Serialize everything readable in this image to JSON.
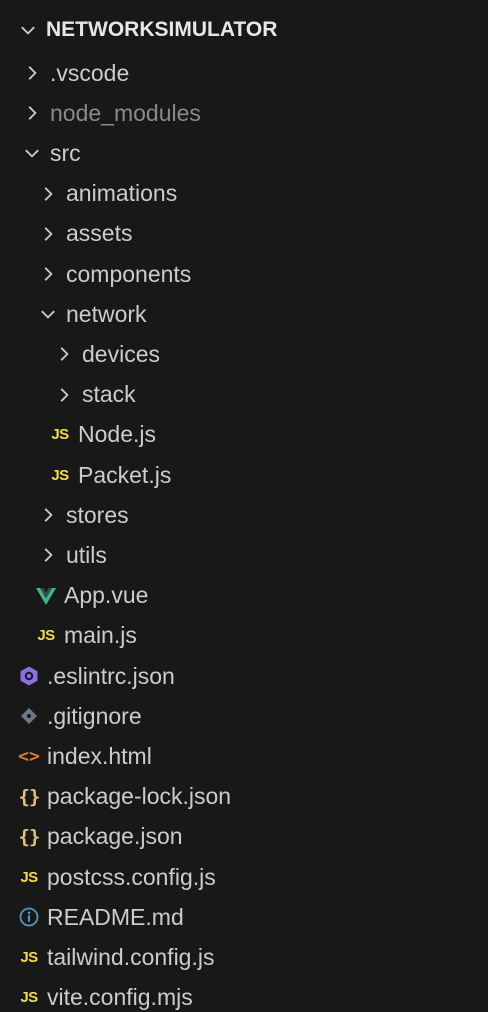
{
  "explorer": {
    "title": "NETWORKSIMULATOR",
    "items": [
      {
        "label": ".vscode",
        "type": "folder",
        "state": "collapsed",
        "depth": 1
      },
      {
        "label": "node_modules",
        "type": "folder",
        "state": "collapsed",
        "depth": 1,
        "dimmed": true
      },
      {
        "label": "src",
        "type": "folder",
        "state": "expanded",
        "depth": 1
      },
      {
        "label": "animations",
        "type": "folder",
        "state": "collapsed",
        "depth": 2
      },
      {
        "label": "assets",
        "type": "folder",
        "state": "collapsed",
        "depth": 2
      },
      {
        "label": "components",
        "type": "folder",
        "state": "collapsed",
        "depth": 2
      },
      {
        "label": "network",
        "type": "folder",
        "state": "expanded",
        "depth": 2
      },
      {
        "label": "devices",
        "type": "folder",
        "state": "collapsed",
        "depth": 3
      },
      {
        "label": "stack",
        "type": "folder",
        "state": "collapsed",
        "depth": 3
      },
      {
        "label": "Node.js",
        "type": "file",
        "icon": "javascript-icon",
        "icon_text": "JS",
        "depth": 3
      },
      {
        "label": "Packet.js",
        "type": "file",
        "icon": "javascript-icon",
        "icon_text": "JS",
        "depth": 3
      },
      {
        "label": "stores",
        "type": "folder",
        "state": "collapsed",
        "depth": 2
      },
      {
        "label": "utils",
        "type": "folder",
        "state": "collapsed",
        "depth": 2
      },
      {
        "label": "App.vue",
        "type": "file",
        "icon": "vue-icon",
        "depth": 2
      },
      {
        "label": "main.js",
        "type": "file",
        "icon": "javascript-icon",
        "icon_text": "JS",
        "depth": 2
      },
      {
        "label": ".eslintrc.json",
        "type": "file",
        "icon": "eslint-icon",
        "depth": 1
      },
      {
        "label": ".gitignore",
        "type": "file",
        "icon": "git-icon",
        "depth": 1
      },
      {
        "label": "index.html",
        "type": "file",
        "icon": "html-icon",
        "icon_text": "<>",
        "depth": 1
      },
      {
        "label": "package-lock.json",
        "type": "file",
        "icon": "json-icon",
        "icon_text": "{}",
        "depth": 1
      },
      {
        "label": "package.json",
        "type": "file",
        "icon": "json-icon",
        "icon_text": "{}",
        "depth": 1
      },
      {
        "label": "postcss.config.js",
        "type": "file",
        "icon": "javascript-icon",
        "icon_text": "JS",
        "depth": 1
      },
      {
        "label": "README.md",
        "type": "file",
        "icon": "info-icon",
        "depth": 1
      },
      {
        "label": "tailwind.config.js",
        "type": "file",
        "icon": "javascript-icon",
        "icon_text": "JS",
        "depth": 1
      },
      {
        "label": "vite.config.mjs",
        "type": "file",
        "icon": "javascript-icon",
        "icon_text": "JS",
        "depth": 1
      }
    ]
  },
  "colors": {
    "background": "#181818",
    "text": "#cccccc",
    "dim_text": "#8a8a8a",
    "js": "#f0db4f",
    "json": "#e5c07b",
    "html": "#e37933",
    "vue_green": "#41b883",
    "vue_dark": "#8bc34a",
    "eslint": "#8c6fe0",
    "git": "#6b7785",
    "info": "#519aba"
  }
}
